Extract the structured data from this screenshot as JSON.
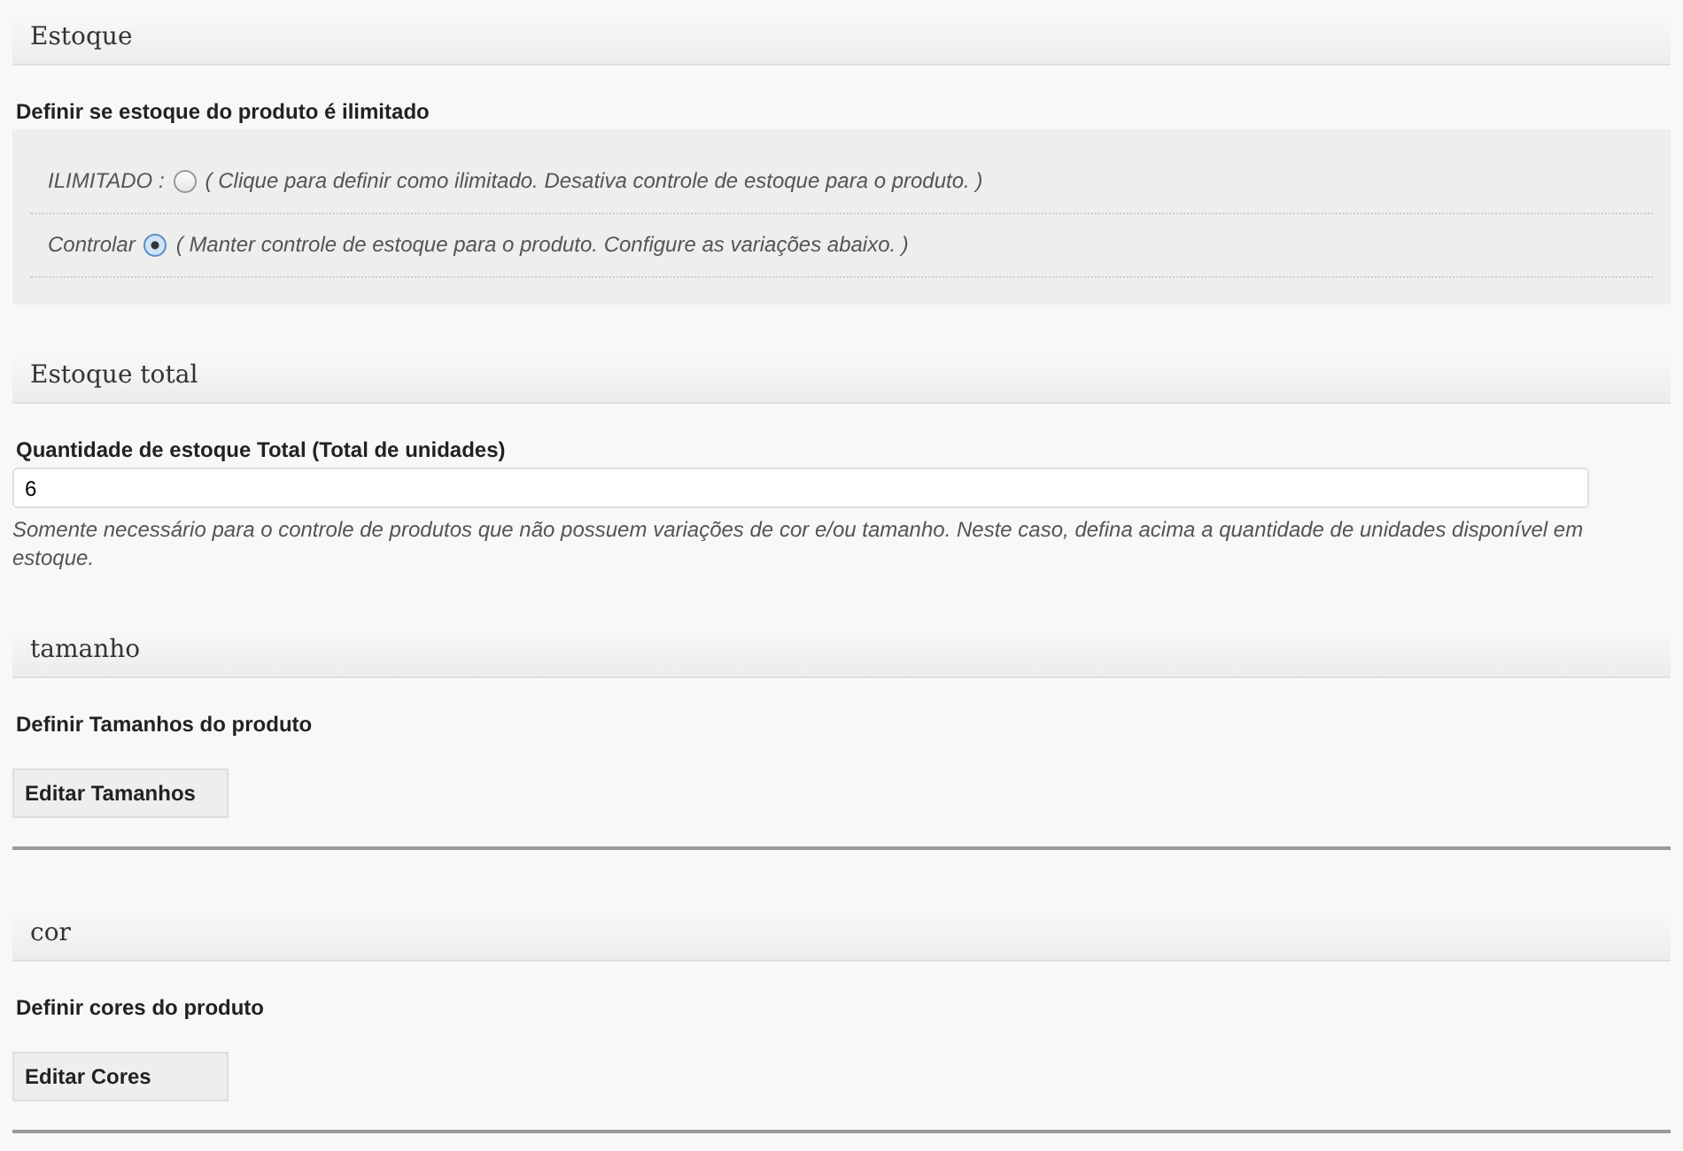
{
  "sections": [
    {
      "kind": "radio",
      "title": "Estoque",
      "label": "Definir se estoque do produto é ilimitado",
      "options": [
        {
          "label": "ILIMITADO :",
          "hint": "( Clique para definir como ilimitado. Desativa controle de estoque para o produto. )",
          "selected": false
        },
        {
          "label": "Controlar",
          "hint": "( Manter controle de estoque para o produto. Configure as variações abaixo. )",
          "selected": true
        }
      ]
    },
    {
      "kind": "quantity",
      "title": "Estoque total",
      "label": "Quantidade de estoque Total (Total de unidades)",
      "value": "6",
      "help": "Somente necessário para o controle de produtos que não possuem variações de cor e/ou tamanho. Neste caso, defina acima a quantidade de unidades disponível em estoque."
    },
    {
      "kind": "button",
      "title": "tamanho",
      "label": "Definir Tamanhos do produto",
      "button": "Editar Tamanhos"
    },
    {
      "kind": "button",
      "title": "cor",
      "label": "Definir cores do produto",
      "button": "Editar Cores"
    }
  ]
}
